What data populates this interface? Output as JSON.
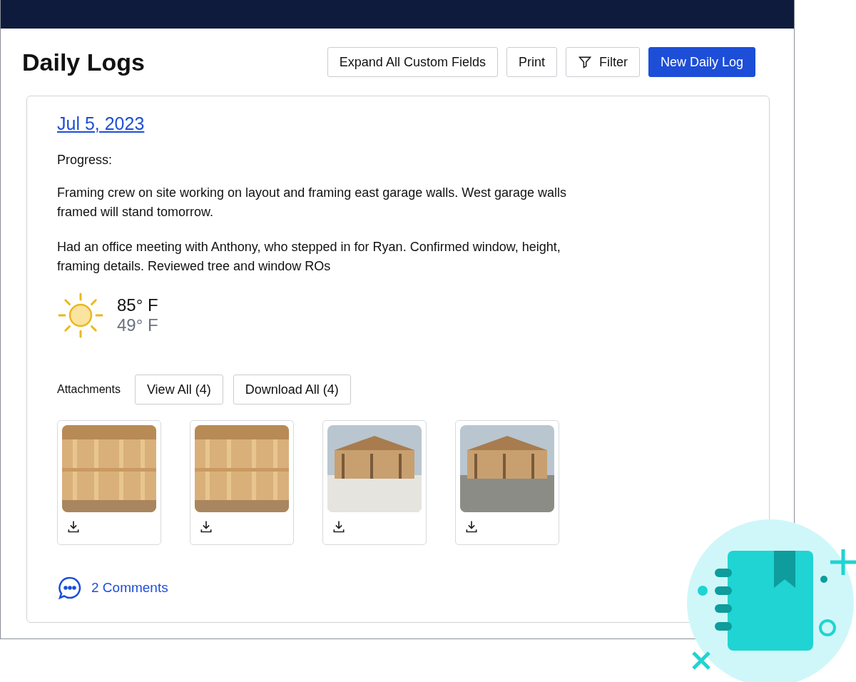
{
  "header": {
    "title": "Daily Logs",
    "buttons": [
      {
        "label": "Expand All Custom Fields",
        "kind": "outline"
      },
      {
        "label": "Print",
        "kind": "outline"
      },
      {
        "label": "Filter",
        "kind": "filter"
      },
      {
        "label": "New Daily Log",
        "kind": "primary"
      }
    ]
  },
  "log": {
    "date": "Jul 5, 2023",
    "section": "Progress:",
    "paragraphs": [
      "Framing crew on site working on layout and framing east garage walls. West garage walls framed will stand tomorrow.",
      "Had an office meeting with Anthony, who stepped in for Ryan. Confirmed window, height, framing details. Reviewed tree and window ROs"
    ],
    "weather": {
      "high": "85° F",
      "low": "49° F"
    },
    "attachments": {
      "label": "Attachments",
      "buttons": [
        "View All (4)",
        "Download All (4)"
      ]
    },
    "comments": "2 Comments"
  }
}
